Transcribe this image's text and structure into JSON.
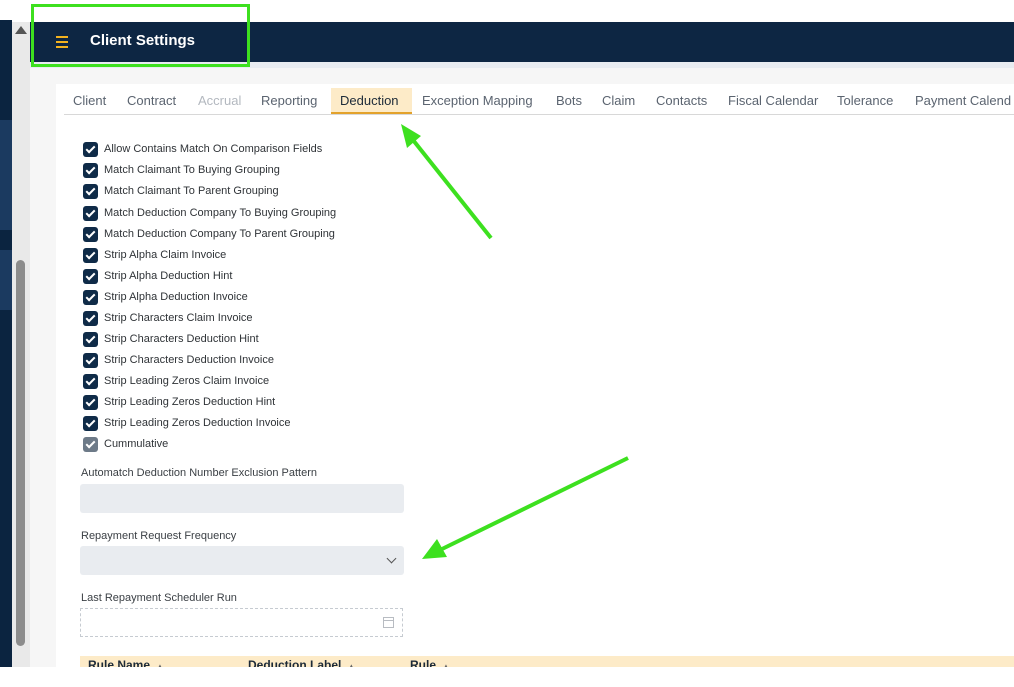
{
  "app": {
    "title": "Client Settings",
    "menu_icon": "hamburger-icon",
    "header_color": "#0d2643",
    "accent": "#f2b21f"
  },
  "tabs": [
    {
      "label": "Client",
      "state": "normal"
    },
    {
      "label": "Contract",
      "state": "normal"
    },
    {
      "label": "Accrual",
      "state": "disabled"
    },
    {
      "label": "Reporting",
      "state": "normal"
    },
    {
      "label": "Deduction",
      "state": "active"
    },
    {
      "label": "Exception Mapping",
      "state": "normal"
    },
    {
      "label": "Bots",
      "state": "normal"
    },
    {
      "label": "Claim",
      "state": "normal"
    },
    {
      "label": "Contacts",
      "state": "normal"
    },
    {
      "label": "Fiscal Calendar",
      "state": "normal"
    },
    {
      "label": "Tolerance",
      "state": "normal"
    },
    {
      "label": "Payment Calend",
      "state": "normal"
    }
  ],
  "checkboxes": [
    {
      "label": "Allow Contains Match On Comparison Fields",
      "checked": true
    },
    {
      "label": "Match Claimant To Buying Grouping",
      "checked": true
    },
    {
      "label": "Match Claimant To Parent Grouping",
      "checked": true
    },
    {
      "label": "Match Deduction Company To Buying Grouping",
      "checked": true
    },
    {
      "label": "Match Deduction Company To Parent Grouping",
      "checked": true
    },
    {
      "label": "Strip Alpha Claim Invoice",
      "checked": true
    },
    {
      "label": "Strip Alpha Deduction Hint",
      "checked": true
    },
    {
      "label": "Strip Alpha Deduction Invoice",
      "checked": true
    },
    {
      "label": "Strip Characters Claim Invoice",
      "checked": true
    },
    {
      "label": "Strip Characters Deduction Hint",
      "checked": true
    },
    {
      "label": "Strip Characters Deduction Invoice",
      "checked": true
    },
    {
      "label": "Strip Leading Zeros Claim Invoice",
      "checked": true
    },
    {
      "label": "Strip Leading Zeros Deduction Hint",
      "checked": true
    },
    {
      "label": "Strip Leading Zeros Deduction Invoice",
      "checked": true
    },
    {
      "label": "Cummulative",
      "checked": true,
      "disabled": true
    }
  ],
  "fields": {
    "exclusion_pattern": {
      "label": "Automatch Deduction Number Exclusion Pattern",
      "value": ""
    },
    "repayment_frequency": {
      "label": "Repayment Request Frequency",
      "value": "",
      "icon": "chevron-down-icon"
    },
    "last_scheduler_run": {
      "label": "Last Repayment Scheduler Run",
      "value": "",
      "icon": "calendar-icon"
    }
  },
  "grid": {
    "columns": [
      {
        "label": "Rule Name",
        "sort": "▲"
      },
      {
        "label": "Deduction Label",
        "sort": "▲"
      },
      {
        "label": "Rule",
        "sort": "▲"
      }
    ]
  },
  "annotations": {
    "highlight_color": "#3de01f"
  }
}
